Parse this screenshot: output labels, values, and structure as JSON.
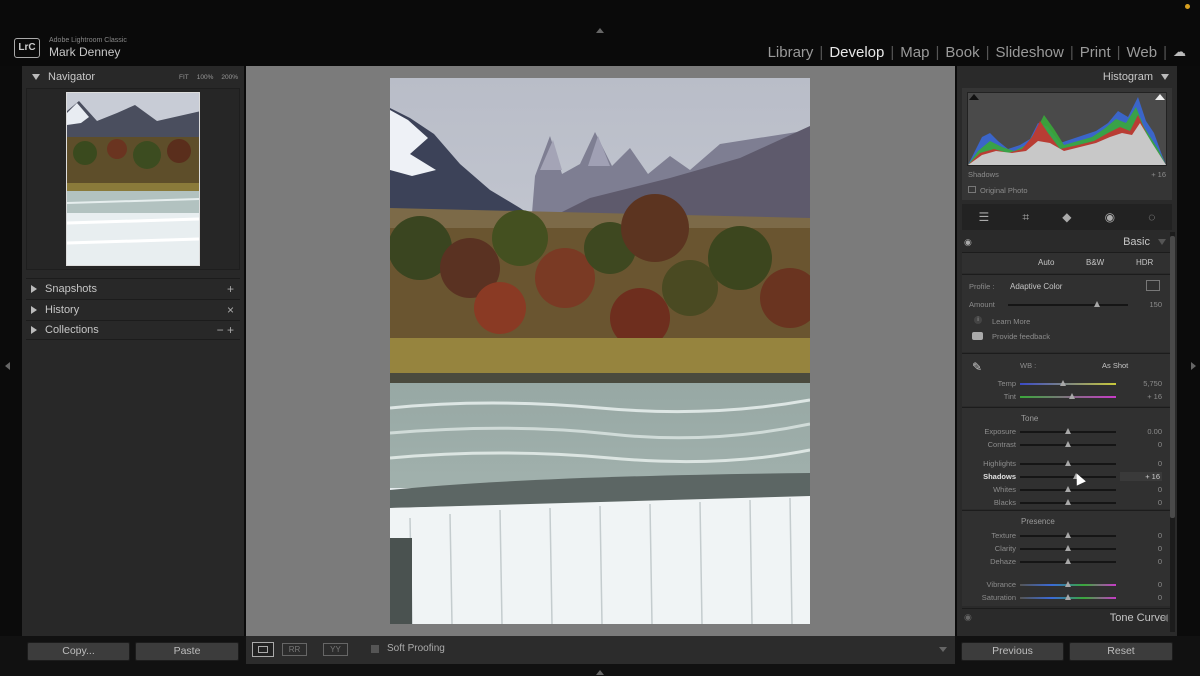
{
  "app": {
    "product": "Adobe Lightroom Classic",
    "user": "Mark Denney",
    "logo_text": "LrC"
  },
  "modules": [
    {
      "label": "Library",
      "active": false
    },
    {
      "label": "Develop",
      "active": true
    },
    {
      "label": "Map",
      "active": false
    },
    {
      "label": "Book",
      "active": false
    },
    {
      "label": "Slideshow",
      "active": false
    },
    {
      "label": "Print",
      "active": false
    },
    {
      "label": "Web",
      "active": false
    }
  ],
  "navigator": {
    "title": "Navigator",
    "zoom": [
      "FIT",
      "100%",
      "200%"
    ]
  },
  "left_sections": [
    {
      "label": "Snapshots",
      "action": "+"
    },
    {
      "label": "History",
      "action": "×"
    },
    {
      "label": "Collections",
      "action": "−  +"
    }
  ],
  "histogram": {
    "title": "Histogram",
    "info_label": "Shadows",
    "info_value": "+ 16",
    "original_photo": "Original Photo"
  },
  "basic": {
    "title": "Basic",
    "treatments": [
      "Auto",
      "B&W",
      "HDR"
    ],
    "profile_label": "Profile :",
    "profile_value": "Adaptive Color",
    "amount_label": "Amount",
    "amount_value": "150",
    "amount_level": 0.74,
    "learn_more": "Learn More",
    "provide_feedback": "Provide feedback",
    "wb_label": "WB :",
    "wb_value": "As Shot",
    "wb_sliders": [
      {
        "label": "Temp",
        "value": "5,750",
        "level": 0.45
      },
      {
        "label": "Tint",
        "value": "+ 16",
        "level": 0.54
      }
    ],
    "tone_header": "Tone",
    "tone_sliders": [
      {
        "label": "Exposure",
        "value": "0.00",
        "level": 0.5
      },
      {
        "label": "Contrast",
        "value": "0",
        "level": 0.5
      },
      {
        "label": "Highlights",
        "value": "0",
        "level": 0.5
      },
      {
        "label": "Shadows",
        "value": "+ 16",
        "level": 0.58,
        "active": true
      },
      {
        "label": "Whites",
        "value": "0",
        "level": 0.5
      },
      {
        "label": "Blacks",
        "value": "0",
        "level": 0.5
      }
    ],
    "presence_header": "Presence",
    "presence_sliders": [
      {
        "label": "Texture",
        "value": "0",
        "level": 0.5
      },
      {
        "label": "Clarity",
        "value": "0",
        "level": 0.5
      },
      {
        "label": "Dehaze",
        "value": "0",
        "level": 0.5
      },
      {
        "label": "Vibrance",
        "value": "0",
        "level": 0.5
      },
      {
        "label": "Saturation",
        "value": "0",
        "level": 0.5
      }
    ]
  },
  "tone_curve": {
    "title": "Tone Curve"
  },
  "toolbar": {
    "soft_proofing": "Soft Proofing"
  },
  "left_buttons": {
    "copy": "Copy...",
    "paste": "Paste"
  },
  "right_buttons": {
    "previous": "Previous",
    "reset": "Reset"
  },
  "colors": {
    "accent_red": "#c83232",
    "accent_green": "#3aa83a",
    "accent_blue": "#3a6ad8"
  }
}
